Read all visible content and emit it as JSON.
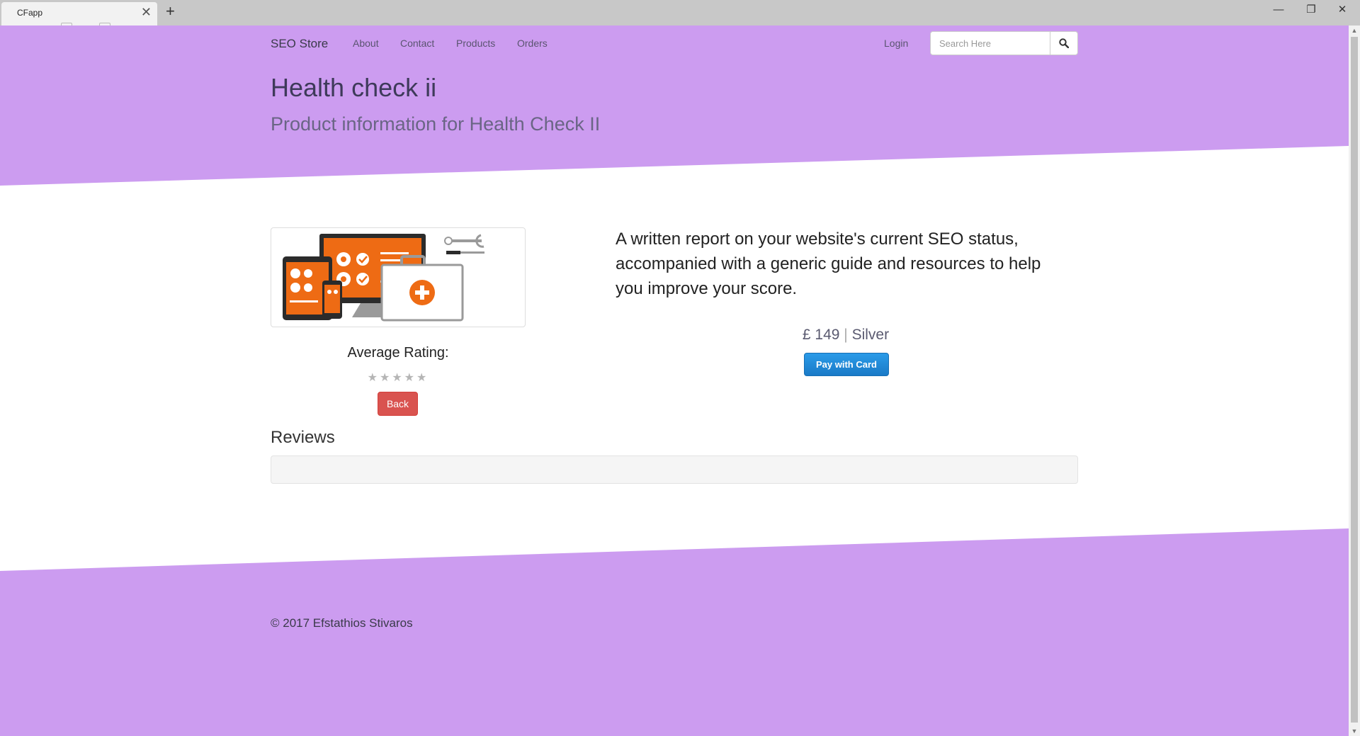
{
  "browser": {
    "tab_title": "CFapp",
    "close_glyph": "✕",
    "new_tab_glyph": "+",
    "minimize_glyph": "—",
    "maximize_glyph": "❐",
    "close_window_glyph": "✕"
  },
  "nav": {
    "brand": "SEO Store",
    "links": [
      "About",
      "Contact",
      "Products",
      "Orders"
    ],
    "login": "Login",
    "search_placeholder": "Search Here"
  },
  "hero": {
    "title": "Health check ii",
    "subtitle": "Product information for Health Check II"
  },
  "product": {
    "image_icon": "health-check-illustration",
    "rating_label": "Average Rating:",
    "rating_value": 0,
    "rating_max": 5,
    "stars": "★★★★★",
    "back_label": "Back",
    "description": "A written report on your website's current SEO status, accompanied with a generic guide and resources to help you improve your score.",
    "price": "£ 149",
    "price_separator": "|",
    "tier": "Silver",
    "pay_label": "Pay with Card"
  },
  "reviews": {
    "heading": "Reviews"
  },
  "footer": {
    "copyright": "© 2017 Efstathios Stivaros"
  },
  "colors": {
    "accent_purple": "#cc9cf0",
    "danger_red": "#d9534f",
    "pay_blue": "#1a7ac7",
    "illustration_orange": "#ee6b14"
  }
}
